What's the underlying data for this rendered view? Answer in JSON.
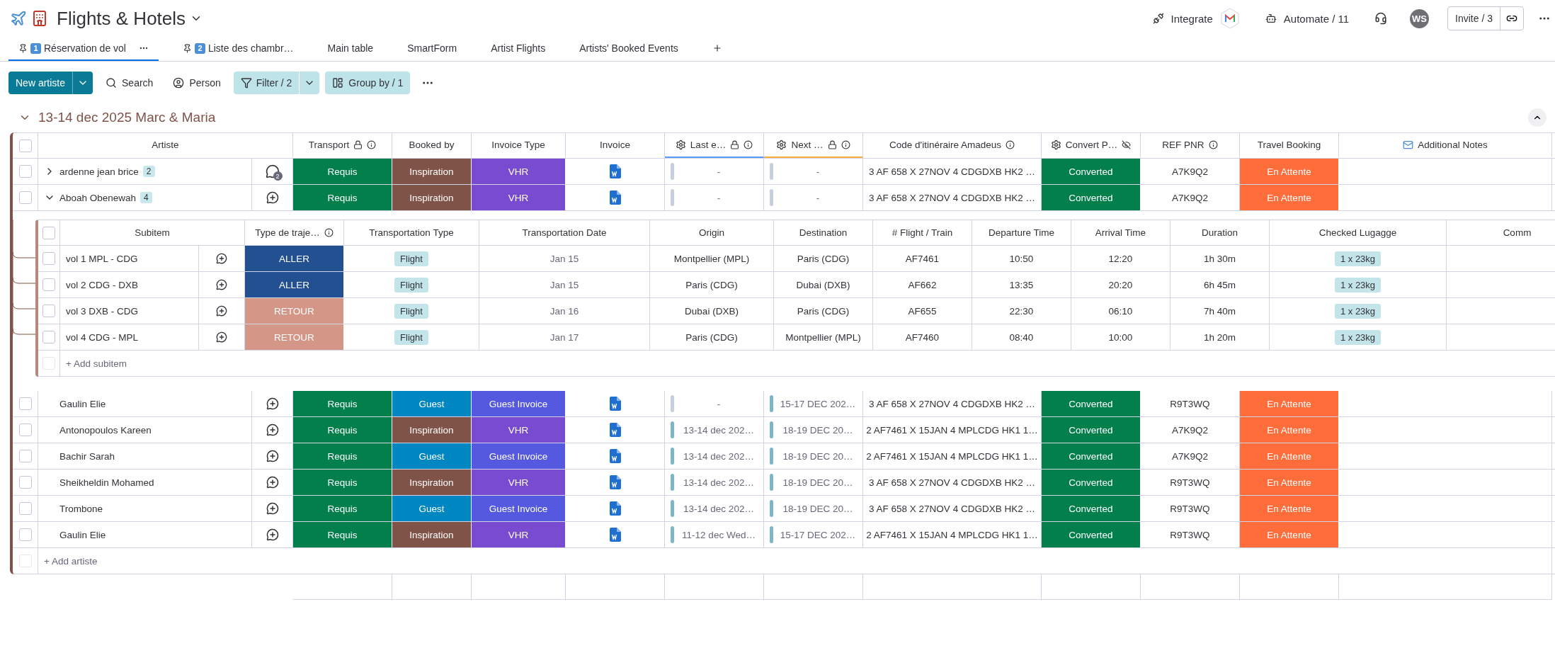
{
  "header": {
    "title": "Flights & Hotels",
    "integrate": "Integrate",
    "automate": "Automate / 11",
    "avatar": "WS",
    "invite": "Invite / 3"
  },
  "views": [
    {
      "number": "1",
      "label": "Réservation de vol",
      "pinned": true,
      "selected": true
    },
    {
      "number": "2",
      "label": "Liste des chambr…",
      "pinned": true,
      "selected": false
    },
    {
      "label": "Main table",
      "pinned": false,
      "selected": false
    },
    {
      "label": "SmartForm",
      "pinned": false,
      "selected": false
    },
    {
      "label": "Artist Flights",
      "pinned": false,
      "selected": false
    },
    {
      "label": "Artists' Booked Events",
      "pinned": false,
      "selected": false
    }
  ],
  "toolbar": {
    "new_item": "New artiste",
    "search": "Search",
    "person": "Person",
    "filter": "Filter / 2",
    "group_by": "Group by / 1"
  },
  "group": {
    "title": "13-14 dec 2025 Marc & Maria",
    "color": "#7f5347",
    "expanded": true,
    "all_checked": false,
    "columns": [
      {
        "label": "Artiste"
      },
      {
        "label": "Transport",
        "locked": true,
        "info": true
      },
      {
        "label": "Booked by"
      },
      {
        "label": "Invoice Type"
      },
      {
        "label": "Invoice"
      },
      {
        "label": "Last e…",
        "kind": "gear",
        "locked": true,
        "info": true,
        "color": "#579bfc"
      },
      {
        "label": "Next …",
        "kind": "gear",
        "locked": true,
        "info": true,
        "color": "#fdab3d"
      },
      {
        "label": "Code d'itinéraire Amadeus",
        "info": true
      },
      {
        "label": "Convert P…",
        "kind": "gear",
        "hidden": true
      },
      {
        "label": "REF PNR",
        "info": true
      },
      {
        "label": "Travel Booking"
      },
      {
        "label": "Additional Notes",
        "kind": "notes"
      }
    ],
    "rows": [
      {
        "name": "ardenne jean brice",
        "checked": false,
        "subitems": "2",
        "expanded": false,
        "updates": "2",
        "transport": {
          "label": "Requis",
          "color": "#037f4c"
        },
        "booked_by": {
          "label": "Inspiration",
          "color": "#7f5347"
        },
        "invoice_type": {
          "label": "VHR",
          "color": "#784bd1"
        },
        "last_event": {
          "text": "-",
          "color": "#c5d0dc"
        },
        "next_event": {
          "text": "-",
          "color": "#c5d0dc"
        },
        "code": "3 AF 658 X 27NOV 4 CDGDXB HK2 …",
        "convert": {
          "label": "Converted",
          "color": "#037f4c"
        },
        "ref": "A7K9Q2",
        "travel": {
          "label": "En Attente",
          "color": "#ff6d3b"
        }
      },
      {
        "name": "Aboah Obenewah",
        "checked": false,
        "subitems": "4",
        "expanded": true,
        "transport": {
          "label": "Requis",
          "color": "#037f4c"
        },
        "booked_by": {
          "label": "Inspiration",
          "color": "#7f5347"
        },
        "invoice_type": {
          "label": "VHR",
          "color": "#784bd1"
        },
        "last_event": {
          "text": "-",
          "color": "#c5d0dc"
        },
        "next_event": {
          "text": "-",
          "color": "#c5d0dc"
        },
        "code": "3 AF 658 X 27NOV 4 CDGDXB HK2 …",
        "convert": {
          "label": "Converted",
          "color": "#037f4c"
        },
        "ref": "A7K9Q2",
        "travel": {
          "label": "En Attente",
          "color": "#ff6d3b"
        },
        "subtable": {
          "all_checked": false,
          "columns": [
            "Subitem",
            "Type de traje…",
            "Transportation Type",
            "Transportation Date",
            "Origin",
            "Destination",
            "# Flight / Train",
            "Departure Time",
            "Arrival Time",
            "Duration",
            "Checked Lugagge",
            "Comm"
          ],
          "rows": [
            {
              "name": "vol 1 MPL - CDG",
              "checked": false,
              "type": {
                "label": "ALLER",
                "color": "#225091"
              },
              "transportation_type": "Flight",
              "date": "Jan 15",
              "origin": "Montpellier (MPL)",
              "destination": "Paris (CDG)",
              "flight": "AF7461",
              "departure": "10:50",
              "arrival": "12:20",
              "duration": "1h 30m",
              "luggage": "1 x 23kg"
            },
            {
              "name": "vol 2 CDG - DXB",
              "checked": false,
              "type": {
                "label": "ALLER",
                "color": "#225091"
              },
              "transportation_type": "Flight",
              "date": "Jan 15",
              "origin": "Paris (CDG)",
              "destination": "Dubai (DXB)",
              "flight": "AF662",
              "departure": "13:35",
              "arrival": "20:20",
              "duration": "6h 45m",
              "luggage": "1 x 23kg"
            },
            {
              "name": "vol 3 DXB - CDG",
              "checked": false,
              "type": {
                "label": "RETOUR",
                "color": "#d39687"
              },
              "transportation_type": "Flight",
              "date": "Jan 16",
              "origin": "Dubai (DXB)",
              "destination": "Paris (CDG)",
              "flight": "AF655",
              "departure": "22:30",
              "arrival": "06:10",
              "duration": "7h 40m",
              "luggage": "1 x 23kg"
            },
            {
              "name": "vol 4 CDG - MPL",
              "checked": false,
              "type": {
                "label": "RETOUR",
                "color": "#d39687"
              },
              "transportation_type": "Flight",
              "date": "Jan 17",
              "origin": "Paris (CDG)",
              "destination": "Montpellier (MPL)",
              "flight": "AF7460",
              "departure": "08:40",
              "arrival": "10:00",
              "duration": "1h 20m",
              "luggage": "1 x 23kg"
            }
          ],
          "add": "+ Add subitem"
        }
      },
      {
        "name": "Gaulin Elie",
        "checked": false,
        "transport": {
          "label": "Requis",
          "color": "#037f4c"
        },
        "booked_by": {
          "label": "Guest",
          "color": "#0086c0"
        },
        "invoice_type": {
          "label": "Guest Invoice",
          "color": "#5559df"
        },
        "last_event": {
          "text": "-",
          "color": "#c5d0dc"
        },
        "next_event": {
          "text": "15-17 DEC 202…",
          "color": "#7eb6c9"
        },
        "code": "3 AF 658 X 27NOV 4 CDGDXB HK2 …",
        "convert": {
          "label": "Converted",
          "color": "#037f4c"
        },
        "ref": "R9T3WQ",
        "travel": {
          "label": "En Attente",
          "color": "#ff6d3b"
        }
      },
      {
        "name": "Antonopoulos Kareen",
        "checked": false,
        "transport": {
          "label": "Requis",
          "color": "#037f4c"
        },
        "booked_by": {
          "label": "Inspiration",
          "color": "#7f5347"
        },
        "invoice_type": {
          "label": "VHR",
          "color": "#784bd1"
        },
        "last_event": {
          "text": "13-14 dec 202…",
          "color": "#7eb6c9"
        },
        "next_event": {
          "text": "18-19 DEC 20…",
          "color": "#7eb6c9"
        },
        "code": "2 AF7461 X 15JAN 4 MPLCDG HK1 1…",
        "convert": {
          "label": "Converted",
          "color": "#037f4c"
        },
        "ref": "A7K9Q2",
        "travel": {
          "label": "En Attente",
          "color": "#ff6d3b"
        }
      },
      {
        "name": "Bachir Sarah",
        "checked": false,
        "transport": {
          "label": "Requis",
          "color": "#037f4c"
        },
        "booked_by": {
          "label": "Guest",
          "color": "#0086c0"
        },
        "invoice_type": {
          "label": "Guest Invoice",
          "color": "#5559df"
        },
        "last_event": {
          "text": "13-14 dec 202…",
          "color": "#7eb6c9"
        },
        "next_event": {
          "text": "18-19 DEC 20…",
          "color": "#7eb6c9"
        },
        "code": "2 AF7461 X 15JAN 4 MPLCDG HK1 1…",
        "convert": {
          "label": "Converted",
          "color": "#037f4c"
        },
        "ref": "A7K9Q2",
        "travel": {
          "label": "En Attente",
          "color": "#ff6d3b"
        }
      },
      {
        "name": "Sheikheldin Mohamed",
        "checked": false,
        "transport": {
          "label": "Requis",
          "color": "#037f4c"
        },
        "booked_by": {
          "label": "Inspiration",
          "color": "#7f5347"
        },
        "invoice_type": {
          "label": "VHR",
          "color": "#784bd1"
        },
        "last_event": {
          "text": "13-14 dec 202…",
          "color": "#7eb6c9"
        },
        "next_event": {
          "text": "18-19 DEC 20…",
          "color": "#7eb6c9"
        },
        "code": "3 AF 658 X 27NOV 4 CDGDXB HK2 …",
        "convert": {
          "label": "Converted",
          "color": "#037f4c"
        },
        "ref": "R9T3WQ",
        "travel": {
          "label": "En Attente",
          "color": "#ff6d3b"
        }
      },
      {
        "name": "Trombone",
        "checked": false,
        "transport": {
          "label": "Requis",
          "color": "#037f4c"
        },
        "booked_by": {
          "label": "Guest",
          "color": "#0086c0"
        },
        "invoice_type": {
          "label": "Guest Invoice",
          "color": "#5559df"
        },
        "last_event": {
          "text": "13-14 dec 202…",
          "color": "#7eb6c9"
        },
        "next_event": {
          "text": "18-19 DEC 20…",
          "color": "#7eb6c9"
        },
        "code": "3 AF 658 X 27NOV 4 CDGDXB HK2 …",
        "convert": {
          "label": "Converted",
          "color": "#037f4c"
        },
        "ref": "R9T3WQ",
        "travel": {
          "label": "En Attente",
          "color": "#ff6d3b"
        }
      },
      {
        "name": "Gaulin Elie",
        "checked": false,
        "transport": {
          "label": "Requis",
          "color": "#037f4c"
        },
        "booked_by": {
          "label": "Inspiration",
          "color": "#7f5347"
        },
        "invoice_type": {
          "label": "VHR",
          "color": "#784bd1"
        },
        "last_event": {
          "text": "11-12 dec Wed…",
          "color": "#7eb6c9"
        },
        "next_event": {
          "text": "15-17 DEC 202…",
          "color": "#7eb6c9"
        },
        "code": "2 AF7461 X 15JAN 4 MPLCDG HK1 1…",
        "convert": {
          "label": "Converted",
          "color": "#037f4c"
        },
        "ref": "R9T3WQ",
        "travel": {
          "label": "En Attente",
          "color": "#ff6d3b"
        }
      }
    ],
    "add": "+ Add artiste"
  }
}
